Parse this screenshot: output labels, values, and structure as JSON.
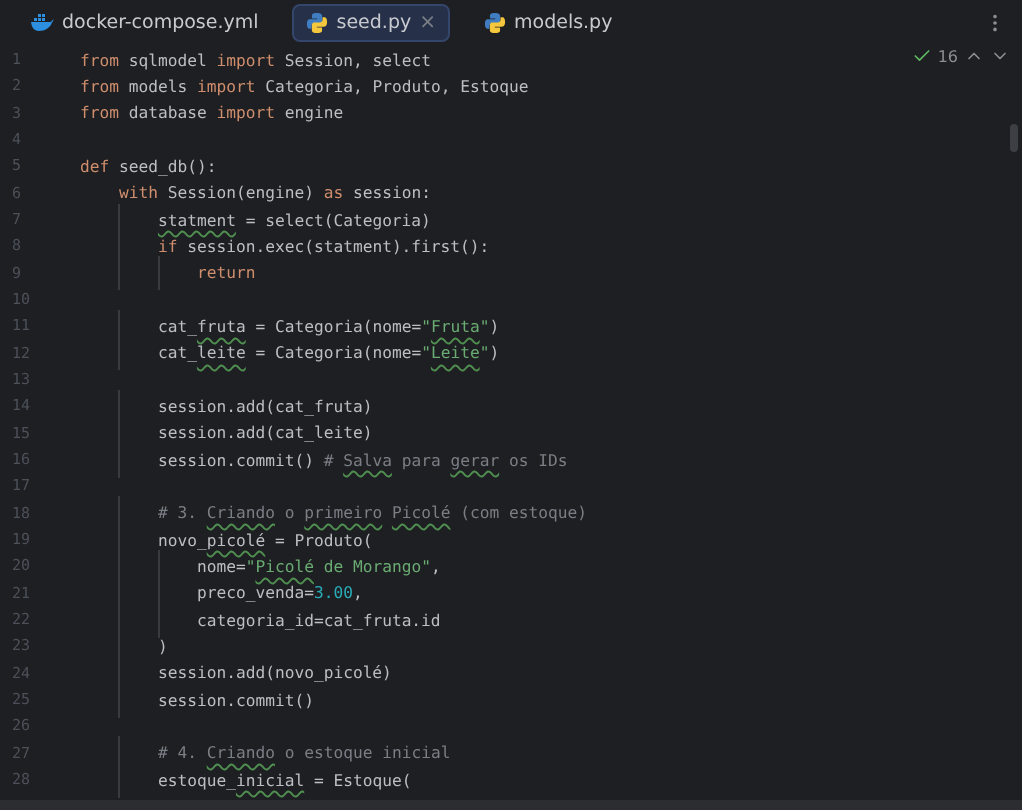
{
  "tabs": [
    {
      "label": "docker-compose.yml",
      "kind": "docker",
      "selected": false
    },
    {
      "label": "seed.py",
      "kind": "python",
      "selected": true,
      "close": "×"
    },
    {
      "label": "models.py",
      "kind": "python",
      "selected": false
    }
  ],
  "inspection": {
    "count": "16"
  },
  "lines": [
    {
      "number": "1",
      "tokens": [
        {
          "text": "from",
          "kind": "kw"
        },
        {
          "text": " sqlmodel ",
          "kind": "text"
        },
        {
          "text": "import",
          "kind": "kw"
        },
        {
          "text": " Session, select",
          "kind": "text"
        }
      ]
    },
    {
      "number": "2",
      "tokens": [
        {
          "text": "from",
          "kind": "kw"
        },
        {
          "text": " models ",
          "kind": "text"
        },
        {
          "text": "import",
          "kind": "kw"
        },
        {
          "text": " Categoria, Produto, Estoque",
          "kind": "text"
        }
      ]
    },
    {
      "number": "3",
      "tokens": [
        {
          "text": "from",
          "kind": "kw"
        },
        {
          "text": " database ",
          "kind": "text"
        },
        {
          "text": "import",
          "kind": "kw"
        },
        {
          "text": " engine",
          "kind": "text"
        }
      ]
    },
    {
      "number": "4"
    },
    {
      "number": "5",
      "tokens": [
        {
          "text": "def",
          "kind": "kw"
        },
        {
          "text": " seed_db():",
          "kind": "text"
        }
      ]
    },
    {
      "number": "6",
      "tokens": [
        {
          "text": "    with",
          "kind": "kw"
        },
        {
          "text": " Session(engine) ",
          "kind": "text"
        },
        {
          "text": "as",
          "kind": "kw"
        },
        {
          "text": " session:",
          "kind": "text"
        }
      ]
    },
    {
      "number": "7",
      "tokens": [
        {
          "text": "        statment",
          "kind": "typo"
        },
        {
          "text": " = select(Categoria)",
          "kind": "text"
        }
      ]
    },
    {
      "number": "8",
      "tokens": [
        {
          "text": "        if",
          "kind": "kw"
        },
        {
          "text": " session.exec(statment).first():",
          "kind": "text"
        }
      ]
    },
    {
      "number": "9",
      "tokens": [
        {
          "text": "            return",
          "kind": "kw"
        }
      ]
    },
    {
      "number": "10"
    },
    {
      "number": "11",
      "tokens": [
        {
          "text": "        cat_",
          "kind": "text"
        },
        {
          "text": "fruta",
          "kind": "typo"
        },
        {
          "text": " = Categoria(nome=",
          "kind": "text"
        },
        {
          "text": "\"",
          "kind": "str"
        },
        {
          "text": "Fruta",
          "kind": "typostr"
        },
        {
          "text": "\"",
          "kind": "str"
        },
        {
          "text": ")",
          "kind": "text"
        }
      ]
    },
    {
      "number": "12",
      "tokens": [
        {
          "text": "        cat_",
          "kind": "text"
        },
        {
          "text": "leite",
          "kind": "typo"
        },
        {
          "text": " = Categoria(nome=",
          "kind": "text"
        },
        {
          "text": "\"",
          "kind": "str"
        },
        {
          "text": "Leite",
          "kind": "typostr"
        },
        {
          "text": "\"",
          "kind": "str"
        },
        {
          "text": ")",
          "kind": "text"
        }
      ]
    },
    {
      "number": "13"
    },
    {
      "number": "14",
      "tokens": [
        {
          "text": "        session.add(cat_fruta)",
          "kind": "text"
        }
      ]
    },
    {
      "number": "15",
      "tokens": [
        {
          "text": "        session.add(cat_leite)",
          "kind": "text"
        }
      ]
    },
    {
      "number": "16",
      "tokens": [
        {
          "text": "        session.commit() ",
          "kind": "text"
        },
        {
          "text": "# ",
          "kind": "comment"
        },
        {
          "text": "Salva",
          "kind": "typocomment"
        },
        {
          "text": " para ",
          "kind": "comment"
        },
        {
          "text": "gerar",
          "kind": "typocomment"
        },
        {
          "text": " os IDs",
          "kind": "comment"
        }
      ]
    },
    {
      "number": "17"
    },
    {
      "number": "18",
      "tokens": [
        {
          "text": "        # 3. ",
          "kind": "comment"
        },
        {
          "text": "Criando",
          "kind": "typocomment"
        },
        {
          "text": " o ",
          "kind": "comment"
        },
        {
          "text": "primeiro",
          "kind": "typocomment"
        },
        {
          "text": " Picolé",
          "kind": "typocomment"
        },
        {
          "text": " (com estoque)",
          "kind": "comment"
        }
      ]
    },
    {
      "number": "19",
      "tokens": [
        {
          "text": "        novo_",
          "kind": "text"
        },
        {
          "text": "picolé",
          "kind": "typo"
        },
        {
          "text": " = Produto(",
          "kind": "text"
        }
      ]
    },
    {
      "number": "20",
      "tokens": [
        {
          "text": "            nome=",
          "kind": "text"
        },
        {
          "text": "\"",
          "kind": "str"
        },
        {
          "text": "Picolé",
          "kind": "typostr"
        },
        {
          "text": " de Morango\"",
          "kind": "str"
        },
        {
          "text": ",",
          "kind": "text"
        }
      ]
    },
    {
      "number": "21",
      "tokens": [
        {
          "text": "            preco_venda=",
          "kind": "text"
        },
        {
          "text": "3.00",
          "kind": "num"
        },
        {
          "text": ",",
          "kind": "text"
        }
      ]
    },
    {
      "number": "22",
      "tokens": [
        {
          "text": "            categoria_id=cat_fruta.id",
          "kind": "text"
        }
      ]
    },
    {
      "number": "23",
      "tokens": [
        {
          "text": "        )",
          "kind": "text"
        }
      ]
    },
    {
      "number": "24",
      "tokens": [
        {
          "text": "        session.add(novo_picolé)",
          "kind": "text"
        }
      ]
    },
    {
      "number": "25",
      "tokens": [
        {
          "text": "        session.commit()",
          "kind": "text"
        }
      ]
    },
    {
      "number": "26"
    },
    {
      "number": "27",
      "tokens": [
        {
          "text": "        # 4. ",
          "kind": "comment"
        },
        {
          "text": "Criando",
          "kind": "typocomment"
        },
        {
          "text": " o estoque inicial",
          "kind": "comment"
        }
      ]
    },
    {
      "number": "28",
      "tokens": [
        {
          "text": "        estoque_",
          "kind": "text"
        },
        {
          "text": "inicial",
          "kind": "typo"
        },
        {
          "text": " = Estoque(",
          "kind": "text"
        }
      ]
    }
  ]
}
